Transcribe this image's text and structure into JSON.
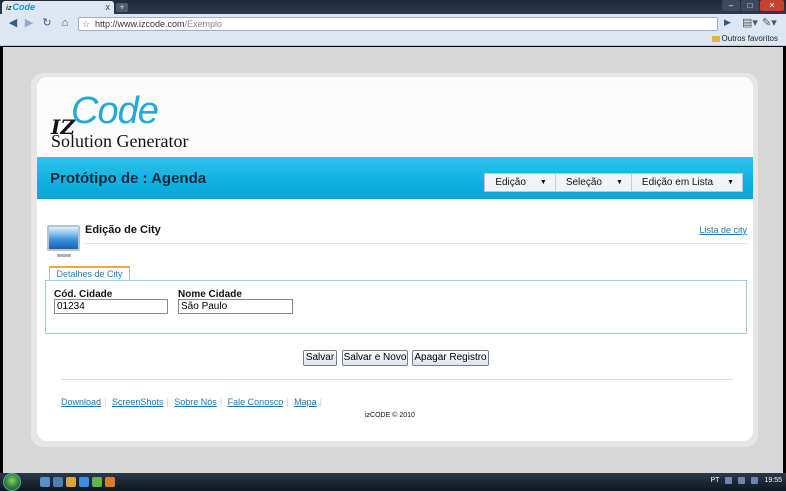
{
  "browser": {
    "tab_title": "Code",
    "tab_logo_prefix": "iz",
    "tab_close": "x",
    "new_tab": "+",
    "url_host": "http://www.izcode.com",
    "url_path": "/Exemplo",
    "bookmark_other": "Outros favoritos"
  },
  "logo": {
    "iz": "IZ",
    "code": "Code",
    "subtitle": "Solution Generator"
  },
  "banner": {
    "title": "Protótipo de : Agenda",
    "menu": [
      {
        "label": "Edição"
      },
      {
        "label": "Seleção"
      },
      {
        "label": "Edição em Lista"
      }
    ]
  },
  "section": {
    "title": "Edição de City",
    "list_link": "Lista de city"
  },
  "form": {
    "tab_label": "Detalhes de City",
    "fields": [
      {
        "label": "Cód. Cidade",
        "value": "01234"
      },
      {
        "label": "Nome Cidade",
        "value": "São Paulo"
      }
    ]
  },
  "actions": {
    "save": "Salvar",
    "save_new": "Salvar e Novo",
    "delete": "Apagar Registro"
  },
  "footer": {
    "links": [
      "Download",
      "ScreenShots",
      "Sobre Nós",
      "Fale Conosco",
      "Mapa"
    ],
    "separator": "|",
    "copyright": "izCODE © 2010"
  },
  "taskbar": {
    "lang": "PT",
    "clock": "19:55"
  },
  "colors": {
    "banner": "#0fb2e2",
    "logo": "#22a9d8",
    "link": "#1f73b7"
  }
}
